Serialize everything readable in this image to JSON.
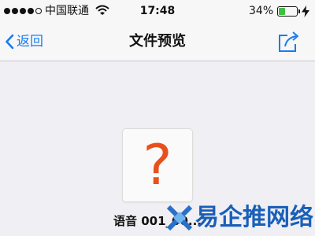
{
  "status_bar": {
    "carrier": "中国联通",
    "time": "17:48",
    "battery_percent": "34%",
    "battery_level": 0.34,
    "signal_bars_filled": 4,
    "signal_bars_total": 5,
    "icons": [
      "signal-icon",
      "wifi-icon",
      "battery-icon",
      "charging-icon"
    ]
  },
  "nav": {
    "back_label": "返回",
    "title": "文件预览",
    "icons": [
      "chevron-left-icon",
      "share-icon"
    ]
  },
  "file": {
    "icon": "unknown-file-icon",
    "icon_glyph": "?",
    "name": "语音 001_00..."
  },
  "watermark": {
    "text": "易企推网络",
    "icon": "logo-icon"
  },
  "colors": {
    "accent": "#1a7cf0",
    "question_mark": "#e8501e",
    "battery": "#3ec13e",
    "watermark": "#1a5fb8",
    "background": "#efeff4"
  }
}
